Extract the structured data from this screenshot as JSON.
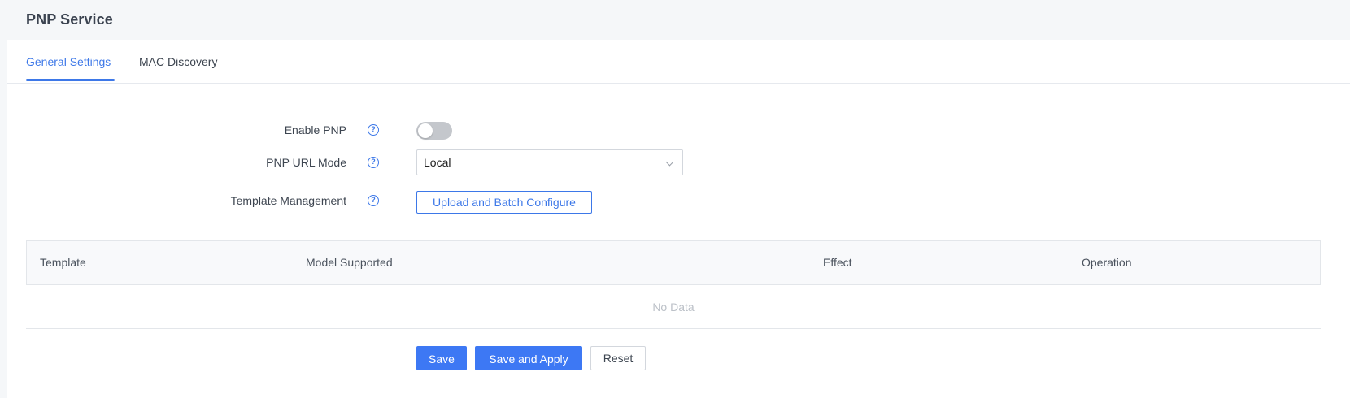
{
  "page": {
    "title": "PNP Service"
  },
  "tabs": [
    {
      "label": "General Settings",
      "active": true
    },
    {
      "label": "MAC Discovery",
      "active": false
    }
  ],
  "form": {
    "enable_pnp": {
      "label": "Enable PNP",
      "value": false
    },
    "url_mode": {
      "label": "PNP URL Mode",
      "value": "Local"
    },
    "template_management": {
      "label": "Template Management",
      "button": "Upload and Batch Configure"
    },
    "help_glyph": "?"
  },
  "table": {
    "columns": [
      "Template",
      "Model Supported",
      "Effect",
      "Operation"
    ],
    "empty_text": "No Data"
  },
  "actions": {
    "save": "Save",
    "save_apply": "Save and Apply",
    "reset": "Reset"
  },
  "colors": {
    "accent": "#3d78e8",
    "primary_button": "#3d78f4"
  }
}
